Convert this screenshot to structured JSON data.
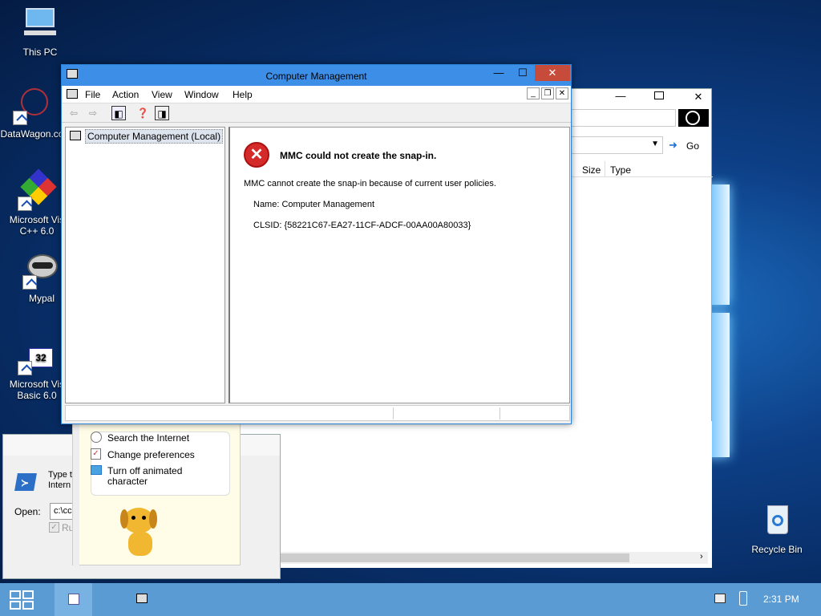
{
  "desktop": {
    "icons": [
      {
        "label": "This PC"
      },
      {
        "label": "DataWagon.co"
      },
      {
        "label": "Microsoft Vis C++ 6.0"
      },
      {
        "label": "Mypal"
      },
      {
        "label": "Microsoft Vis Basic 6.0"
      },
      {
        "label": "Recycle Bin"
      }
    ]
  },
  "main_window": {
    "title": "Computer Management",
    "menu": [
      "File",
      "Action",
      "View",
      "Window",
      "Help"
    ],
    "tree_item": "Computer Management (Local)",
    "error": {
      "heading": "MMC could not create the snap-in.",
      "message": "MMC cannot create the snap-in because of current user policies.",
      "name_line": "Name: Computer Management",
      "clsid_line": "CLSID: {58221C67-EA27-11CF-ADCF-00AA00A80033}"
    }
  },
  "explorer_window": {
    "go_label": "Go",
    "columns": [
      "Size",
      "Type"
    ]
  },
  "run_dialog": {
    "prompt_partial": "Type t Intern",
    "open_label": "Open:",
    "open_value": "c:\\cc",
    "checkbox_label": "Ru"
  },
  "assistant": {
    "options": [
      "Search the Internet",
      "Change preferences",
      "Turn off animated character"
    ]
  },
  "taskbar": {
    "time": "2:31 PM"
  }
}
